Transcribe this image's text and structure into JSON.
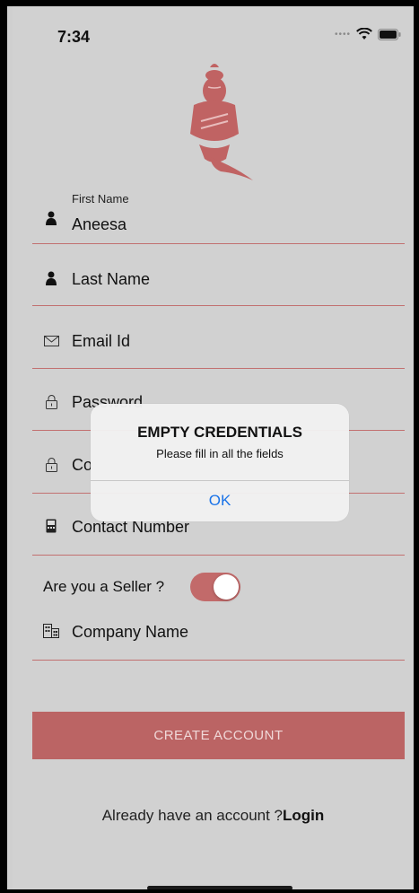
{
  "status_bar": {
    "time": "7:34"
  },
  "form": {
    "first_name": {
      "label": "First Name",
      "value": "Aneesa",
      "icon": "person-icon"
    },
    "last_name": {
      "placeholder": "Last Name",
      "icon": "person-icon"
    },
    "email": {
      "placeholder": "Email Id",
      "icon": "envelope-icon"
    },
    "password": {
      "placeholder": "Password",
      "icon": "lock-icon"
    },
    "confirm_password": {
      "placeholder": "Co",
      "icon": "lock-icon"
    },
    "contact": {
      "placeholder": "Contact Number",
      "icon": "phone-icon"
    },
    "seller": {
      "label": "Are you a Seller ?",
      "enabled": true
    },
    "company": {
      "placeholder": "Company Name",
      "icon": "building-icon"
    }
  },
  "create_button": {
    "label": "CREATE ACCOUNT"
  },
  "login_prompt": {
    "text": "Already have an account ?",
    "link": "Login"
  },
  "alert": {
    "title": "EMPTY CREDENTIALS",
    "message": "Please fill in all the fields",
    "ok_label": "OK"
  },
  "colors": {
    "accent": "#c26a6a",
    "underline": "#c27070",
    "button": "#bb6464",
    "background": "#d1d1d1",
    "link_blue": "#1a73e8"
  }
}
